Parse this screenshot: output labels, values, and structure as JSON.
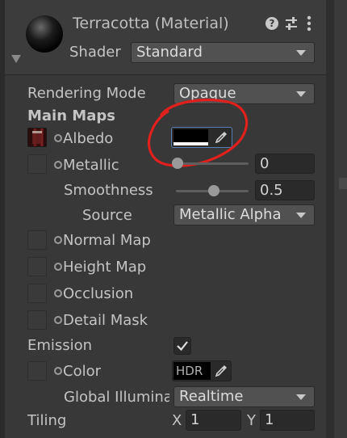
{
  "header": {
    "title": "Terracotta (Material)",
    "shader_label": "Shader",
    "shader_value": "Standard",
    "help_icon": "help-icon",
    "preset_icon": "sliders-icon",
    "more_icon": "kebab-menu-icon"
  },
  "rendering_mode": {
    "label": "Rendering Mode",
    "value": "Opaque"
  },
  "main_maps": {
    "heading": "Main Maps",
    "albedo": {
      "label": "Albedo",
      "color": "#000000"
    },
    "metallic": {
      "label": "Metallic",
      "value": "0",
      "fraction": 0.0
    },
    "smoothness": {
      "label": "Smoothness",
      "value": "0.5",
      "fraction": 0.5
    },
    "source": {
      "label": "Source",
      "value": "Metallic Alpha"
    },
    "normal_map": {
      "label": "Normal Map"
    },
    "height_map": {
      "label": "Height Map"
    },
    "occlusion": {
      "label": "Occlusion"
    },
    "detail_mask": {
      "label": "Detail Mask"
    }
  },
  "emission": {
    "label": "Emission",
    "checked": true,
    "color_label": "Color",
    "hdr_label": "HDR",
    "gi_label": "Global Illumina",
    "gi_value": "Realtime"
  },
  "tiling": {
    "label": "Tiling",
    "x_label": "X",
    "x_value": "1",
    "y_label": "Y",
    "y_value": "1"
  },
  "colors": {
    "annotation": "#e0201c",
    "focus": "#5a7fb5"
  }
}
